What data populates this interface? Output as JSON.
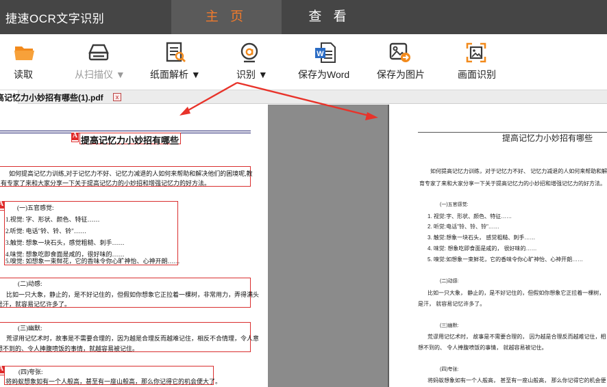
{
  "app": {
    "title": "捷速OCR文字识别"
  },
  "tabs": {
    "home": "主 页",
    "view": "查 看"
  },
  "toolbar": {
    "read": "读取",
    "scan": "从扫描仪 ▼",
    "parse": "纸面解析 ▼",
    "recognize": "识别 ▼",
    "save_word": "保存为Word",
    "save_image": "保存为图片",
    "screen_recognize": "画面识别"
  },
  "file_tab": {
    "name": "高记忆力小妙招有哪些(1).pdf",
    "close": "x"
  },
  "colors": {
    "accent": "#f07a2c",
    "title_bar": "#454545",
    "box_border": "#d92d2d",
    "arrow": "#e8332a"
  },
  "left_doc": {
    "marker": "A",
    "title": "提高记忆力小妙招有哪些",
    "intro_1": "如何提高记忆力训练,对于记忆力不好、记忆力减退的人如何来帮助和解决他们的困境呢,教",
    "intro_2": "有专家了来和大家分享一下关于提高记忆力的小妙招和增强记忆力的好方法。",
    "s1": "(一)五官感觉:",
    "s1_items": [
      "1.视觉: 字、形状、颜色、特征……",
      "2.听觉: 电话\"铃、铃、铃\"……",
      "3.触觉: 想象一块石头，感觉粗糙、刺手……",
      "4.味觉: 想象吃即食面是咸的，很好味的……",
      "5.嗅觉: 如想象一束鲜花，它的香味令你心旷神怡、心神开朗……"
    ],
    "s2": "(二)动感:",
    "s2_1": "比如一只大象，静止的，是不好记住的，但假如你想象它正拉着一棵树，非常用力，弄得满头",
    "s2_2": "是汗，就容易记忆许多了。",
    "s3": "(三)幽默:",
    "s3_1": "荒谬用记忆术时，故事是不需要合理的，因为越是合理反而越难记住，相反不合情理，令人意",
    "s3_2": "想不到的、令人捧腹喷饭的事情，就越容易被记住。",
    "s4": "(四)夸张:",
    "s4_1": "将蚂蚁想象如有一个人般高，甚至有一座山般高，那么你记得它的机会便大了。"
  },
  "right_doc": {
    "title": "提高记忆力小妙招有哪些",
    "intro_1": "如何提高记忆力训练，对于记忆力不好、 记忆力减退的人如何来帮助和解",
    "intro_2": "育专家了来和大家分享一下关于提高记忆力的小妙招和增强记忆力的好方法。",
    "s1": "(一)五官感觉:",
    "s1_items": [
      "1. 视觉:字、形状、颜色、特征……",
      "2. 听觉:电话\"铃、铃、铃\"……",
      "3. 触觉:想象一块石头， 感觉粗糙、刺手……",
      "4. 味觉: 想象吃即食面是咸的， 很好味的……",
      "5. 嗅觉:如想象一束鲜花，它的香味令你心旷神怡、心神开朗……"
    ],
    "s2": "(二)动感:",
    "s2_1": "比如一只大象， 静止的，是不好记住的，但假如你想象它正拉着一棵树，",
    "s2_2": "是汗， 就容易记忆许多了。",
    "s3": "(三)幽默:",
    "s3_1": "荒谬用记忆术时， 故事是不需要合理的， 因为越是合理反而越难记住，相",
    "s3_2": "想不到的、 令人捧腹喷饭的事情， 就越容易被记住。",
    "s4": "(四)夸张:",
    "s4_1": "将蚂蚁想象如有一个人般高， 甚至有一座山般高， 那么你记得它的机会便"
  }
}
